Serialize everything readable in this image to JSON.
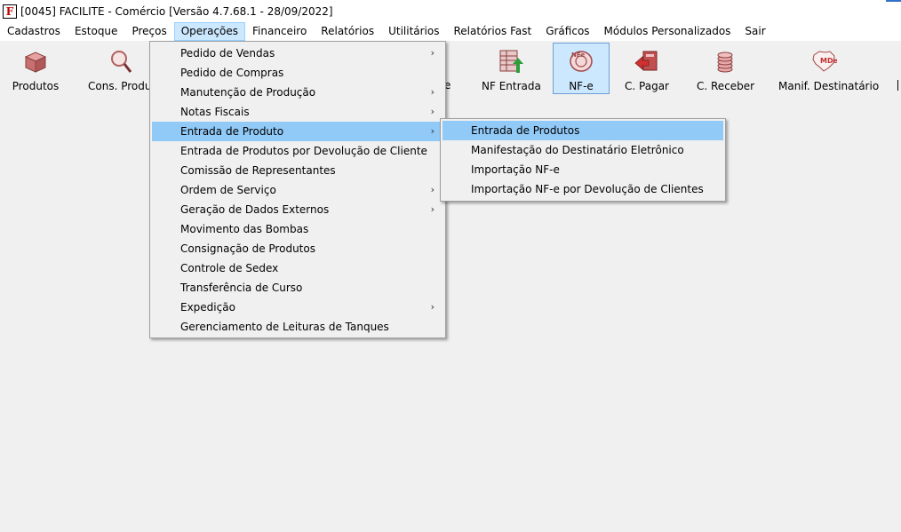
{
  "window": {
    "title": "[0045] FACILITE - Comércio [Versão 4.7.68.1 - 28/09/2022]",
    "icon_letter": "F"
  },
  "menubar": {
    "items": [
      "Cadastros",
      "Estoque",
      "Preços",
      "Operações",
      "Financeiro",
      "Relatórios",
      "Utilitários",
      "Relatórios Fast",
      "Gráficos",
      "Módulos Personalizados",
      "Sair"
    ],
    "active": "Operações"
  },
  "toolbar": {
    "produtos": "Produtos",
    "cons_produto": "Cons. Produto",
    "partial_e": "e",
    "nf_entrada": "NF Entrada",
    "nfe": "NF-e",
    "c_pagar": "C. Pagar",
    "c_receber": "C. Receber",
    "manif": "Manif. Destinatário",
    "nfe_logo_text": "NFe",
    "mde_logo_text": "MDe"
  },
  "operacoes_menu": {
    "items": [
      {
        "label": "Pedido de Vendas",
        "submenu": true
      },
      {
        "label": "Pedido de Compras",
        "submenu": false
      },
      {
        "label": "Manutenção de Produção",
        "submenu": true
      },
      {
        "label": "Notas Fiscais",
        "submenu": true
      },
      {
        "label": "Entrada de Produto",
        "submenu": true,
        "highlighted": true
      },
      {
        "label": "Entrada de Produtos por Devolução de Cliente",
        "submenu": false
      },
      {
        "label": "Comissão de Representantes",
        "submenu": false
      },
      {
        "label": "Ordem de Serviço",
        "submenu": true
      },
      {
        "label": "Geração de Dados Externos",
        "submenu": true
      },
      {
        "label": "Movimento das Bombas",
        "submenu": false
      },
      {
        "label": "Consignação de Produtos",
        "submenu": false
      },
      {
        "label": "Controle de Sedex",
        "submenu": false
      },
      {
        "label": "Transferência de Curso",
        "submenu": false
      },
      {
        "label": "Expedição",
        "submenu": true
      },
      {
        "label": "Gerenciamento de Leituras de Tanques",
        "submenu": false
      }
    ],
    "arrow_glyph": "›"
  },
  "entrada_submenu": {
    "items": [
      {
        "label": "Entrada de Produtos",
        "highlighted": true
      },
      {
        "label": "Manifestação do Destinatário Eletrônico"
      },
      {
        "label": "Importação NF-e"
      },
      {
        "label": "Importação NF-e por Devolução de Clientes"
      }
    ]
  },
  "colors": {
    "menu_active_bg": "#cce8ff",
    "item_highlight_bg": "#91c9f7",
    "pressed_border": "#6f9dd6",
    "brand_red": "#c00000"
  }
}
